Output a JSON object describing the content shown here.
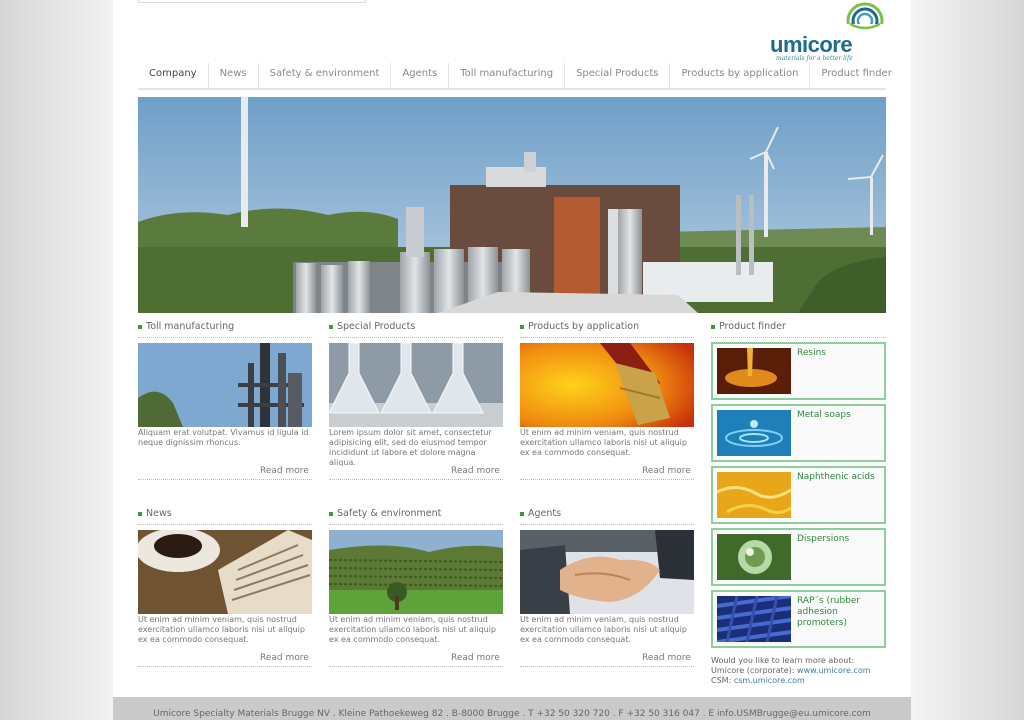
{
  "brand": {
    "name": "umicore",
    "tagline": "materials for a better life"
  },
  "nav": [
    {
      "label": "Company"
    },
    {
      "label": "News"
    },
    {
      "label": "Safety & environment"
    },
    {
      "label": "Agents"
    },
    {
      "label": "Toll manufacturing"
    },
    {
      "label": "Special Products"
    },
    {
      "label": "Products by application"
    },
    {
      "label": "Product finder"
    }
  ],
  "cards": [
    {
      "title": "Toll manufacturing",
      "text": "Aliquam erat volutpat. Vivamus id ligula id neque dignissim rhoncus.",
      "read_more": "Read more"
    },
    {
      "title": "Special Products",
      "text": "Lorem ipsum dolor sit amet, consectetur adipisicing elit, sed do eiusmod tempor incididunt ut labore et dolore magna aliqua.",
      "read_more": "Read more"
    },
    {
      "title": "Products by application",
      "text": "Ut enim ad minim veniam, quis nostrud exercitation ullamco laboris nisi ut aliquip ex ea commodo consequat.",
      "read_more": "Read more"
    },
    {
      "title": "News",
      "text": "Ut enim ad minim veniam, quis nostrud exercitation ullamco laboris nisi ut aliquip ex ea commodo consequat.",
      "read_more": "Read more"
    },
    {
      "title": "Safety & environment",
      "text": "Ut enim ad minim veniam, quis nostrud exercitation ullamco laboris nisi ut aliquip ex ea commodo consequat.",
      "read_more": "Read more"
    },
    {
      "title": "Agents",
      "text": "Ut enim ad minim veniam, quis nostrud exercitation ullamco laboris nisi ut aliquip ex ea commodo consequat.",
      "read_more": "Read more"
    }
  ],
  "product_finder": {
    "title": "Product finder",
    "items": [
      {
        "label": "Resins"
      },
      {
        "label": "Metal soaps"
      },
      {
        "label": "Naphthenic acids"
      },
      {
        "label": "Dispersions"
      },
      {
        "label": "RAP´s (rubber adhesion promoters)"
      }
    ]
  },
  "learn_more": {
    "text": "Would you like to learn more about:",
    "corporate_label": "Umicore (corporate):",
    "corporate_link": "www.umicore.com",
    "csm_label": "CSM:",
    "csm_link": "csm.umicore.com"
  },
  "footer": {
    "text": "Umicore Specialty Materials Brugge NV . Kleine Pathoekeweg 82 . B-8000 Brugge . T +32 50 320 720 . F +32 50 316 047 . E info.USMBrugge@eu.umicore.com"
  },
  "colors": {
    "brand_blue": "#1f6a8e",
    "accent_green": "#3a9a3a",
    "finder_border": "#8ccf9a"
  }
}
